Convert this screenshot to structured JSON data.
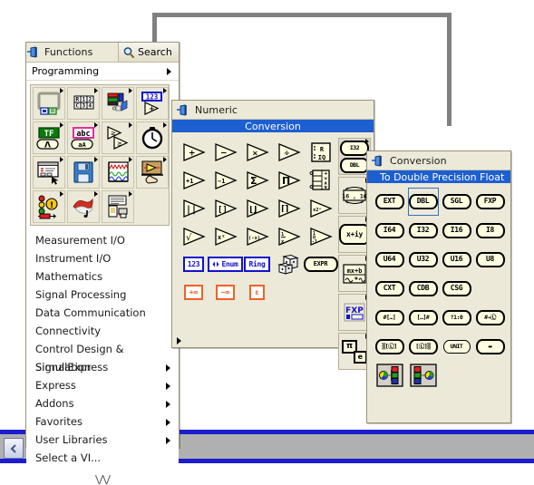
{
  "app": {
    "background_color": "#ffffff",
    "chrome": {
      "scroll_left_icon": "chevron-left-icon",
      "accent_blue": "#1c1cd0",
      "toolbar_gray": "#b0b0b0"
    }
  },
  "functions_palette": {
    "title": "Functions",
    "pin_icon": "pushpin-icon",
    "search_label": "Search",
    "search_icon": "magnifier-icon",
    "category_label": "Programming",
    "icons": [
      {
        "name": "structures-icon",
        "tip": "Structures",
        "has_sub": true
      },
      {
        "name": "array-icon",
        "tip": "Array",
        "has_sub": true
      },
      {
        "name": "cluster-icon",
        "tip": "Cluster, Class, & Variant",
        "has_sub": true
      },
      {
        "name": "numeric-icon",
        "tip": "Numeric",
        "has_sub": true
      },
      {
        "name": "boolean-icon",
        "tip": "Boolean",
        "has_sub": true
      },
      {
        "name": "string-icon",
        "tip": "String",
        "has_sub": true
      },
      {
        "name": "comparison-icon",
        "tip": "Comparison",
        "has_sub": true
      },
      {
        "name": "timing-icon",
        "tip": "Timing",
        "has_sub": true
      },
      {
        "name": "dialog-icon",
        "tip": "Dialog & User Interface",
        "has_sub": true
      },
      {
        "name": "file-io-icon",
        "tip": "File I/O",
        "has_sub": true
      },
      {
        "name": "waveform-icon",
        "tip": "Waveform",
        "has_sub": true
      },
      {
        "name": "app-control-icon",
        "tip": "Application Control",
        "has_sub": true
      },
      {
        "name": "synchronization-icon",
        "tip": "Synchronization",
        "has_sub": true
      },
      {
        "name": "graphics-sound-icon",
        "tip": "Graphics & Sound",
        "has_sub": true
      },
      {
        "name": "report-gen-icon",
        "tip": "Report Generation",
        "has_sub": true
      },
      {
        "name": "blank-icon",
        "tip": "",
        "has_sub": false
      }
    ],
    "menu_items": [
      {
        "label": "Measurement I/O",
        "has_sub": false
      },
      {
        "label": "Instrument I/O",
        "has_sub": false
      },
      {
        "label": "Mathematics",
        "has_sub": false
      },
      {
        "label": "Signal Processing",
        "has_sub": false
      },
      {
        "label": "Data Communication",
        "has_sub": false
      },
      {
        "label": "Connectivity",
        "has_sub": false
      },
      {
        "label": "Control Design & Simulation",
        "has_sub": false
      },
      {
        "label": "SignalExpress",
        "has_sub": true
      },
      {
        "label": "Express",
        "has_sub": true
      },
      {
        "label": "Addons",
        "has_sub": true
      },
      {
        "label": "Favorites",
        "has_sub": true
      },
      {
        "label": "User Libraries",
        "has_sub": true
      },
      {
        "label": "Select a VI...",
        "has_sub": false
      }
    ],
    "expand_chevrons": "⋁⋁"
  },
  "numeric_palette": {
    "title": "Numeric",
    "pin_icon": "pushpin-icon",
    "highlight_label": "Conversion",
    "highlight_color": "#1d5fd0",
    "functions": [
      {
        "name": "add-function",
        "glyph": "+",
        "type": "tri"
      },
      {
        "name": "subtract-function",
        "glyph": "−",
        "type": "tri"
      },
      {
        "name": "multiply-function",
        "glyph": "×",
        "type": "tri"
      },
      {
        "name": "divide-function",
        "glyph": "÷",
        "type": "tri"
      },
      {
        "name": "quotient-remainder-function",
        "glyph": "R IQ",
        "type": "box"
      },
      {
        "name": "increment-function",
        "glyph": "+1",
        "type": "tri"
      },
      {
        "name": "decrement-function",
        "glyph": "−1",
        "type": "tri"
      },
      {
        "name": "add-array-elements-function",
        "glyph": "Σ",
        "type": "tri"
      },
      {
        "name": "multiply-array-elements-function",
        "glyph": "Π",
        "type": "tri"
      },
      {
        "name": "compound-arithmetic-function",
        "glyph": "+ × ∧ ∨",
        "type": "stack"
      },
      {
        "name": "absolute-value-function",
        "glyph": "| |",
        "type": "tri"
      },
      {
        "name": "round-to-nearest-function",
        "glyph": "[ ]",
        "type": "tri"
      },
      {
        "name": "round-toward-neg-infinity-function",
        "glyph": "⌊ ⌋",
        "type": "tri"
      },
      {
        "name": "round-toward-inf-function",
        "glyph": "⌈ ⌉",
        "type": "tri"
      },
      {
        "name": "scale-by-power-of-2-function",
        "glyph": "x2ⁿ",
        "type": "tri"
      },
      {
        "name": "square-root-function",
        "glyph": "√",
        "type": "tri"
      },
      {
        "name": "square-function",
        "glyph": "x²",
        "type": "tri"
      },
      {
        "name": "negate-function",
        "glyph": "(−x)",
        "type": "tri"
      },
      {
        "name": "reciprocal-function",
        "glyph": "1/x",
        "type": "tri"
      },
      {
        "name": "sign-function",
        "glyph": "1 0 −1",
        "type": "tri"
      },
      {
        "name": "numeric-constant",
        "glyph": "123",
        "type": "cbox"
      },
      {
        "name": "enum-constant",
        "glyph": "Enum",
        "type": "cbox"
      },
      {
        "name": "ring-constant",
        "glyph": "Ring",
        "type": "cbox"
      },
      {
        "name": "random-number-function",
        "glyph": "dice",
        "type": "dice"
      },
      {
        "name": "expression-node",
        "glyph": "EXPR",
        "type": "chip"
      },
      {
        "name": "positive-infinity-constant",
        "glyph": "+∞",
        "type": "obox"
      },
      {
        "name": "negative-infinity-constant",
        "glyph": "−∞",
        "type": "obox"
      },
      {
        "name": "machine-epsilon-constant",
        "glyph": "ε",
        "type": "obox"
      }
    ],
    "subpalettes": [
      {
        "name": "conversion-subpalette",
        "label_top": "I32",
        "label_bottom": "DBL",
        "selected": true
      },
      {
        "name": "data-manipulation-subpalette",
        "label_top": "16 , 16",
        "label_bottom": "",
        "selected": false
      },
      {
        "name": "complex-subpalette",
        "label_top": "x+iy",
        "label_bottom": "",
        "selected": false
      },
      {
        "name": "scaling-subpalette",
        "label_top": "mx+b",
        "label_bottom": "",
        "selected": false
      },
      {
        "name": "fixed-point-subpalette",
        "label_top": "FXP",
        "label_bottom": "",
        "selected": false
      },
      {
        "name": "math-constants-subpalette",
        "label_top": "π",
        "label_bottom": "e",
        "selected": false
      }
    ]
  },
  "conversion_palette": {
    "title": "Conversion",
    "pin_icon": "pushpin-icon",
    "highlight_label": "To Double Precision Float",
    "highlight_color": "#1d5fd0",
    "selected_item": "DBL",
    "items": [
      {
        "label": "EXT",
        "name": "to-extended-precision-float",
        "style": "chip",
        "selected": false
      },
      {
        "label": "DBL",
        "name": "to-double-precision-float",
        "style": "chip",
        "selected": true
      },
      {
        "label": "SGL",
        "name": "to-single-precision-float",
        "style": "chip",
        "selected": false
      },
      {
        "label": "FXP",
        "name": "to-fixed-point",
        "style": "chip",
        "selected": false
      },
      {
        "label": "I64",
        "name": "to-quad-integer",
        "style": "chip",
        "selected": false
      },
      {
        "label": "I32",
        "name": "to-long-integer",
        "style": "chip",
        "selected": false
      },
      {
        "label": "I16",
        "name": "to-word-integer",
        "style": "chip",
        "selected": false
      },
      {
        "label": "I8",
        "name": "to-byte-integer",
        "style": "chip",
        "selected": false
      },
      {
        "label": "U64",
        "name": "to-unsigned-quad-integer",
        "style": "chip",
        "selected": false
      },
      {
        "label": "U32",
        "name": "to-unsigned-long-integer",
        "style": "chip",
        "selected": false
      },
      {
        "label": "U16",
        "name": "to-unsigned-word-integer",
        "style": "chip",
        "selected": false
      },
      {
        "label": "U8",
        "name": "to-unsigned-byte-integer",
        "style": "chip",
        "selected": false
      },
      {
        "label": "CXT",
        "name": "to-extended-complex",
        "style": "chip",
        "selected": false
      },
      {
        "label": "CDB",
        "name": "to-double-complex",
        "style": "chip",
        "selected": false
      },
      {
        "label": "CSG",
        "name": "to-single-complex",
        "style": "chip",
        "selected": false
      },
      {
        "label": "",
        "name": "blank-cell",
        "style": "blank",
        "selected": false
      },
      {
        "label": "#[…]",
        "name": "number-to-boolean-array",
        "style": "chip",
        "selected": false
      },
      {
        "label": "[…]#",
        "name": "boolean-array-to-number",
        "style": "chip",
        "selected": false
      },
      {
        "label": "?1:0",
        "name": "boolean-to-0-1",
        "style": "chip",
        "selected": false
      },
      {
        "label": "#→Ⓛ",
        "name": "number-to-enum",
        "style": "chip",
        "selected": false
      },
      {
        "label": "▒[Ⓛ]",
        "name": "string-to-byte-array",
        "style": "chip",
        "selected": false
      },
      {
        "label": "[Ⓛ]▒",
        "name": "byte-array-to-string",
        "style": "chip",
        "selected": false
      },
      {
        "label": "UNIT",
        "name": "convert-unit",
        "style": "chip",
        "selected": false
      },
      {
        "label": "▬",
        "name": "cast-unit-bases",
        "style": "chip",
        "selected": false
      },
      {
        "label": "",
        "name": "flatten-to-string",
        "style": "flatten",
        "selected": false
      },
      {
        "label": "",
        "name": "unflatten-from-string",
        "style": "unflatten",
        "selected": false
      }
    ]
  }
}
